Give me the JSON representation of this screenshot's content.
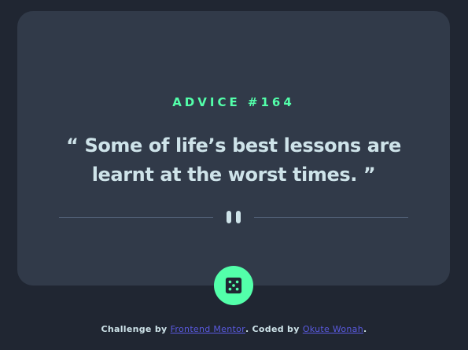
{
  "card": {
    "advice_label": "ADVICE #164",
    "quote": "“ Some of life’s best lessons are learnt at the worst times. ”"
  },
  "divider": {
    "icon": "pause-icon"
  },
  "dice_button": {
    "icon": "dice-icon"
  },
  "footer": {
    "challenge_prefix": "Challenge by ",
    "challenge_link": "Frontend Mentor",
    "coded_prefix": ". Coded by ",
    "author_link": "Okute Wonah",
    "suffix": "."
  },
  "colors": {
    "background": "#202632",
    "card": "#313a49",
    "accent": "#53ffaa",
    "text": "#cee3e9",
    "link": "#5a5ae0"
  }
}
